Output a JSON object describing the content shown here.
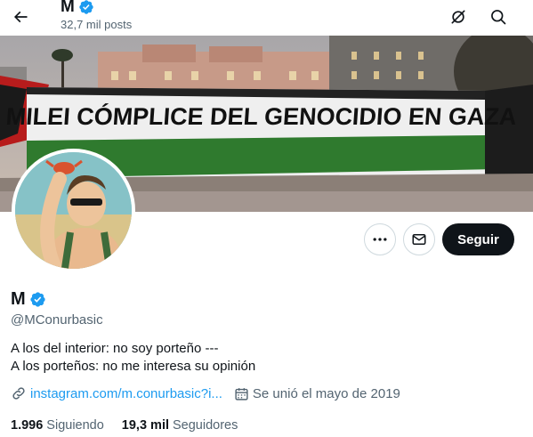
{
  "header": {
    "name": "M",
    "posts_count": "32,7 mil posts"
  },
  "banner": {
    "text": "MILEI CÓMPLICE DEL GENOCIDIO EN GAZA"
  },
  "actions": {
    "follow_label": "Seguir"
  },
  "profile": {
    "name": "M",
    "handle": "@MConurbasic",
    "bio_line1": "A los del interior: no soy porteño ---",
    "bio_line2": "A los porteños: no me interesa su opinión",
    "link": "instagram.com/m.conurbasic?i...",
    "joined": "Se unió el mayo de 2019",
    "following_count": "1.996",
    "following_label": "Siguiendo",
    "followers_count": "19,3 mil",
    "followers_label": "Seguidores"
  },
  "colors": {
    "verified": "#1d9bf0",
    "link": "#1d9bf0",
    "follow_bg": "#0f1419"
  }
}
